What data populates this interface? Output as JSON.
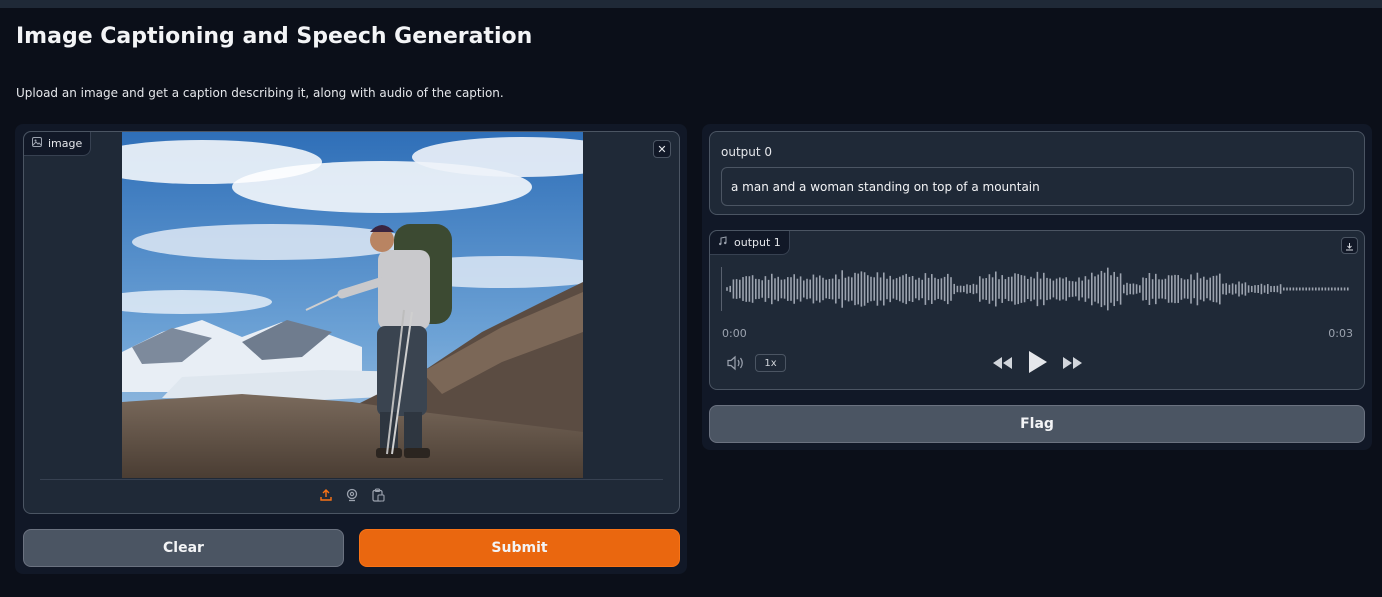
{
  "app": {
    "title": "Image Captioning and Speech Generation",
    "description": "Upload an image and get a caption describing it, along with audio of the caption."
  },
  "input": {
    "label": "image",
    "image_alt": "A hiker with a large backpack and trekking poles standing on a rocky slope with snowy mountains, a glacier and a blue cloudy sky behind him",
    "source_icons": [
      "upload-icon",
      "webcam-icon",
      "clipboard-icon"
    ],
    "close_icon": "close-icon"
  },
  "buttons": {
    "clear": "Clear",
    "submit": "Submit",
    "flag": "Flag"
  },
  "output0": {
    "label": "output 0",
    "value": "a man and a woman standing on top of a mountain"
  },
  "output1": {
    "label": "output 1",
    "time_current": "0:00",
    "time_total": "0:03",
    "playback_speed": "1x",
    "icons": [
      "music-icon",
      "download-icon",
      "volume-icon",
      "rewind-icon",
      "play-icon",
      "fast-forward-icon"
    ]
  },
  "colors": {
    "background": "#0b0f19",
    "panel": "#111827",
    "block": "#1f2937",
    "border": "#4b5563",
    "accent": "#ea670f",
    "secondary_button": "#4b5563",
    "waveform": "#9ca3af"
  }
}
